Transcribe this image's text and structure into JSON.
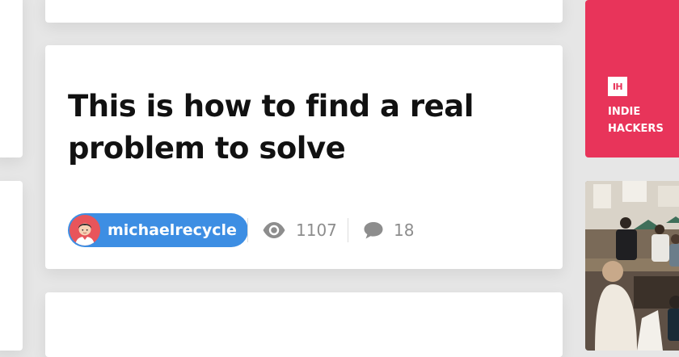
{
  "post": {
    "title": "This is how to find a real problem to solve",
    "author": "michaelrecycle",
    "views": "1107",
    "comments": "18"
  },
  "icons": {
    "views": "eye-icon",
    "comments": "speech-bubble-icon",
    "avatar": "user-avatar-illustration"
  },
  "sidebar_ad": {
    "logo_text": "IH",
    "brand": "INDIE HACKERS",
    "accent": "#e8345a"
  },
  "colors": {
    "author_pill": "#3d8ee3",
    "page_bg": "#e6e6e6",
    "card_bg": "#ffffff"
  }
}
